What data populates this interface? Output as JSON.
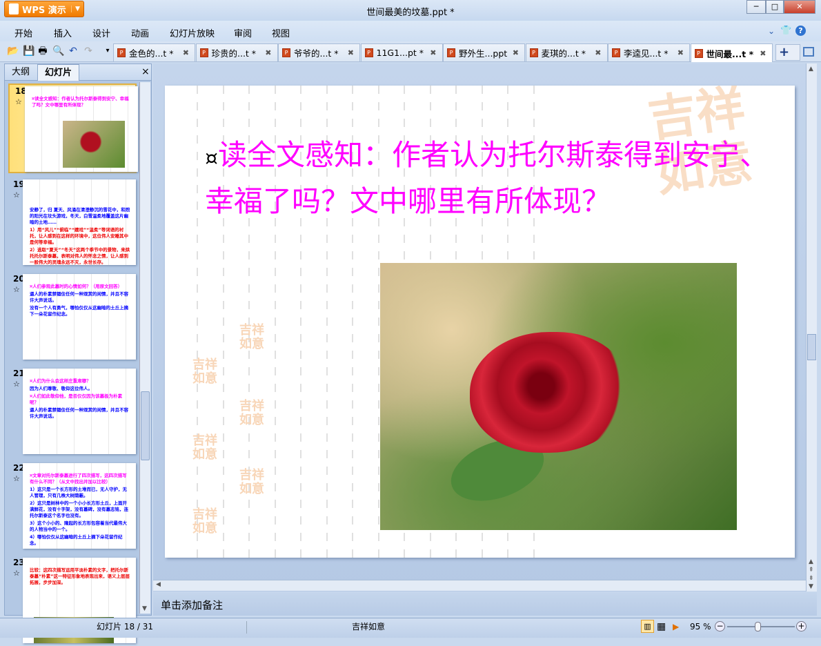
{
  "app": {
    "name": "WPS 演示",
    "window_title": "世间最美的坟墓.ppt *"
  },
  "menu": [
    "开始",
    "插入",
    "设计",
    "动画",
    "幻灯片放映",
    "审阅",
    "视图"
  ],
  "doc_tabs": [
    {
      "label": "金色的...t *",
      "active": false
    },
    {
      "label": "珍贵的...t *",
      "active": false
    },
    {
      "label": "爷爷的...t *",
      "active": false
    },
    {
      "label": "11G1...pt *",
      "active": false
    },
    {
      "label": "野外生...ppt",
      "active": false
    },
    {
      "label": "麦琪的...t *",
      "active": false
    },
    {
      "label": "李逵见...t *",
      "active": false
    },
    {
      "label": "世间最...t *",
      "active": true
    }
  ],
  "panel": {
    "tabs": [
      "大纲",
      "幻灯片"
    ],
    "active_tab": "幻灯片",
    "close": "×"
  },
  "thumbnails": [
    {
      "num": "18",
      "lines": [
        {
          "c": "mg",
          "t": "¤读全文感知：作者认为托尔斯泰得到安宁、幸福了吗？文中哪里有所体现？"
        }
      ]
    },
    {
      "num": "19",
      "lines": [
        {
          "c": "bl",
          "t": "安静了，归 夏天、风涌在清澄静沉的雪花中，和煦的阳光在坟头游戏，冬天，白雪温柔地覆盖这片幽暗的土地……"
        },
        {
          "c": "rd",
          "t": "1）用“风儿”“俯临”“嬉戏”“温柔”等词语的衬托，让人感到在这样的环境中，这位伟人安睡其中是何等幸福。"
        },
        {
          "c": "rd",
          "t": "2）选取“夏天”“冬天”这两个季节中的景物，来烘托托尔斯泰墓，表明对伟人的怀念之情，让人感到一股伟大的灵魂永远不灭，永世长存。"
        }
      ]
    },
    {
      "num": "20",
      "lines": [
        {
          "c": "mg",
          "t": "¤人们参观此墓时的心情如何？（用原文回答）"
        },
        {
          "c": "bl",
          "t": "逼人的朴素禁锢住任何一种观赏的闲情，并且不容许大声说话。"
        },
        {
          "c": "bl",
          "t": "没有一个人有勇气，哪怕仅仅从这幽暗的土丘上摘下一朵花留作纪念。"
        }
      ]
    },
    {
      "num": "21",
      "lines": [
        {
          "c": "mg",
          "t": "¤人们为什么会这样庄重肃穆？"
        },
        {
          "c": "bl",
          "t": "因为人们尊敬、敬仰这位伟人。"
        },
        {
          "c": "mg",
          "t": "¤人们如此敬仰他，是否仅仅因为该墓极为朴素呢？"
        },
        {
          "c": "bl",
          "t": "逼人的朴素禁锢住任何一种观赏的闲情，并且不容许大声说话。"
        }
      ]
    },
    {
      "num": "22",
      "lines": [
        {
          "c": "mg",
          "t": "¤文章对托尔斯泰墓进行了四次描写，这四次描写有什么不同？（从文中找出并加以比较）"
        },
        {
          "c": "bl",
          "t": "1）这只是一个长方形的土堆而已，无人守护，无人管理，只有几株大树荫蔽。"
        },
        {
          "c": "bl",
          "t": "2）这只是树林中的一个小小长方形土丘，上面开满鲜花，没有十字架，没有墓碑，没有墓志铭，连托尔斯泰这个名字也没有。"
        },
        {
          "c": "bl",
          "t": "3）这个小小的、隆起的长方形包容着当代最伟大的人物当中的一个。"
        },
        {
          "c": "bl",
          "t": "4）哪怕仅仅从这幽暗的土丘上摘下朵花留作纪念。"
        }
      ]
    },
    {
      "num": "23",
      "lines": [
        {
          "c": "rd",
          "t": "比较：这四次描写运用平淡朴素的文字，把托尔斯泰墓“朴素”这一特征形象地表现出来，语义上层层拓展，步步加深。"
        }
      ]
    }
  ],
  "slide": {
    "title": "读全文感知：作者认为托尔斯泰得到安宁、幸福了吗？文中哪里有所体现？",
    "bullet": "¤",
    "watermark": "吉祥如意"
  },
  "notes": {
    "placeholder": "单击添加备注"
  },
  "status": {
    "slide_counter": "幻灯片 18 / 31",
    "theme": "吉祥如意",
    "zoom": "95 %",
    "zoom_fraction": 0.45
  },
  "colors": {
    "title": "#ff00ff",
    "accent": "#f07a00"
  }
}
